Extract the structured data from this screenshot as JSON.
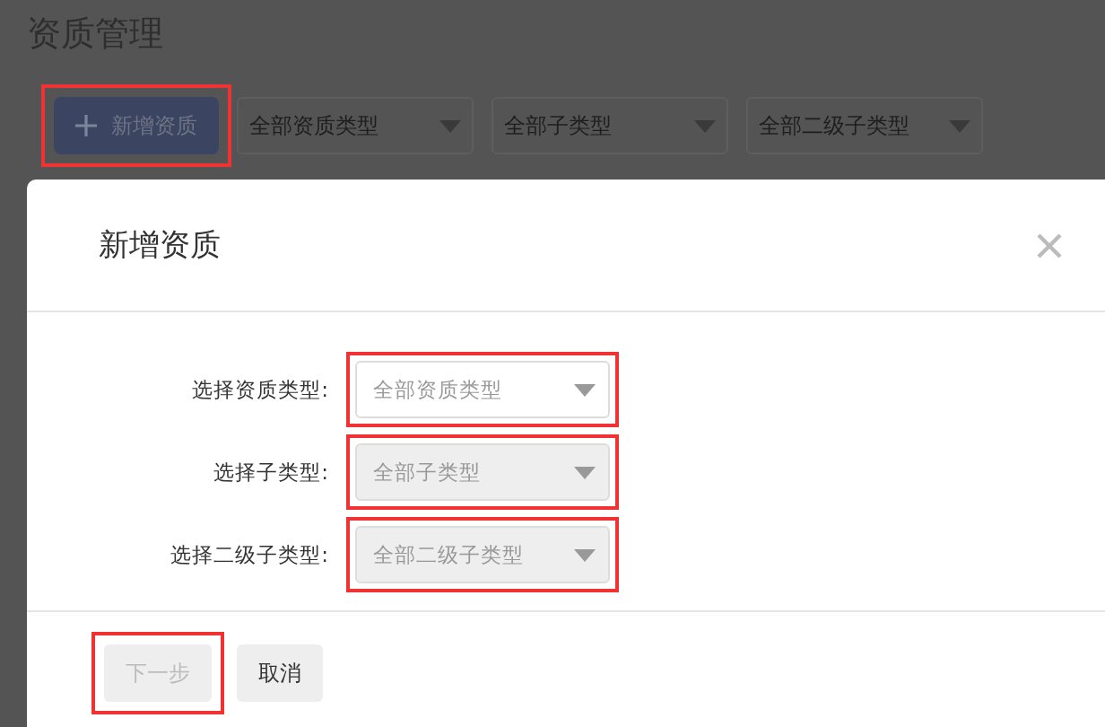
{
  "page": {
    "title": "资质管理",
    "add_button": {
      "label": "新增资质",
      "highlighted": true
    },
    "filters": [
      {
        "placeholder": "全部资质类型"
      },
      {
        "placeholder": "全部子类型"
      },
      {
        "placeholder": "全部二级子类型"
      }
    ]
  },
  "dialog": {
    "title": "新增资质",
    "fields": [
      {
        "label": "选择资质类型:",
        "value": "全部资质类型",
        "disabled": false,
        "highlighted": true
      },
      {
        "label": "选择子类型:",
        "value": "全部子类型",
        "disabled": true,
        "highlighted": true
      },
      {
        "label": "选择二级子类型:",
        "value": "全部二级子类型",
        "disabled": true,
        "highlighted": true
      }
    ],
    "buttons": [
      {
        "label": "下一步",
        "kind": "primary",
        "disabled": true,
        "highlighted": true
      },
      {
        "label": "取消",
        "kind": "default",
        "disabled": false,
        "highlighted": false
      }
    ]
  }
}
